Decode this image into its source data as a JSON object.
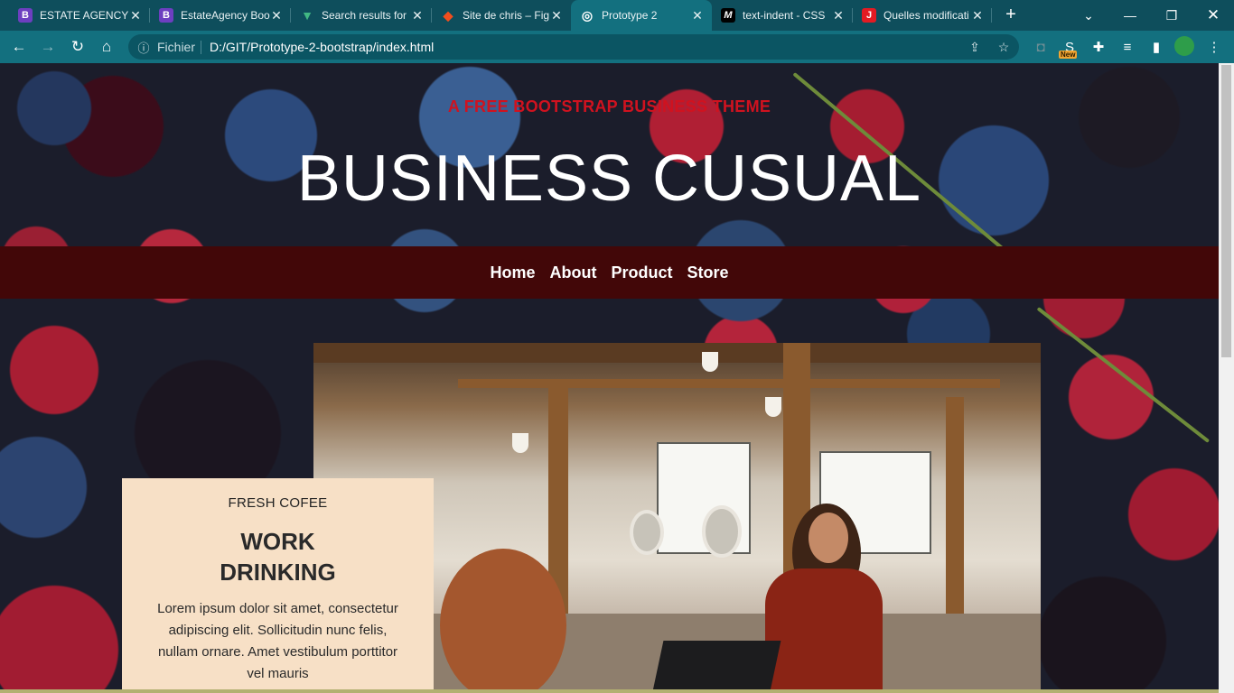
{
  "browser": {
    "tabs": [
      {
        "label": "ESTATE AGENCY",
        "favicon": "B",
        "favicon_color": "#6d3fc0"
      },
      {
        "label": "EstateAgency Boo",
        "favicon": "B",
        "favicon_color": "#6d3fc0"
      },
      {
        "label": "Search results for",
        "favicon": "▼",
        "favicon_color": "#41b883"
      },
      {
        "label": "Site de chris – Fig",
        "favicon": "◆",
        "favicon_color": "#f24e1e"
      },
      {
        "label": "Prototype 2",
        "favicon": "◎",
        "favicon_color": "#13707f",
        "active": true
      },
      {
        "label": "text-indent - CSS",
        "favicon": "M",
        "favicon_color": "#000000"
      },
      {
        "label": "Quelles modificati",
        "favicon": "J",
        "favicon_color": "#e31b23"
      }
    ],
    "address": {
      "scheme_label": "Fichier",
      "url": "D:/GIT/Prototype-2-bootstrap/index.html"
    },
    "extension_badge": "New"
  },
  "site": {
    "subtitle": "A FREE BOOTSTRAP BUSINESS THEME",
    "brand": "BUSINESS CUSUAL",
    "nav": [
      "Home",
      "About",
      "Product",
      "Store"
    ],
    "card": {
      "kicker": "FRESH COFEE",
      "heading": "WORK DRINKING",
      "body": "Lorem ipsum dolor sit amet, consectetur adipiscing elit. Sollicitudin nunc felis, nullam ornare. Amet vestibulum porttitor vel mauris"
    }
  },
  "colors": {
    "subtitle": "#d0121f",
    "nav_background": "#420708",
    "card_background": "#f7e0c6",
    "chrome": "#13707f"
  }
}
